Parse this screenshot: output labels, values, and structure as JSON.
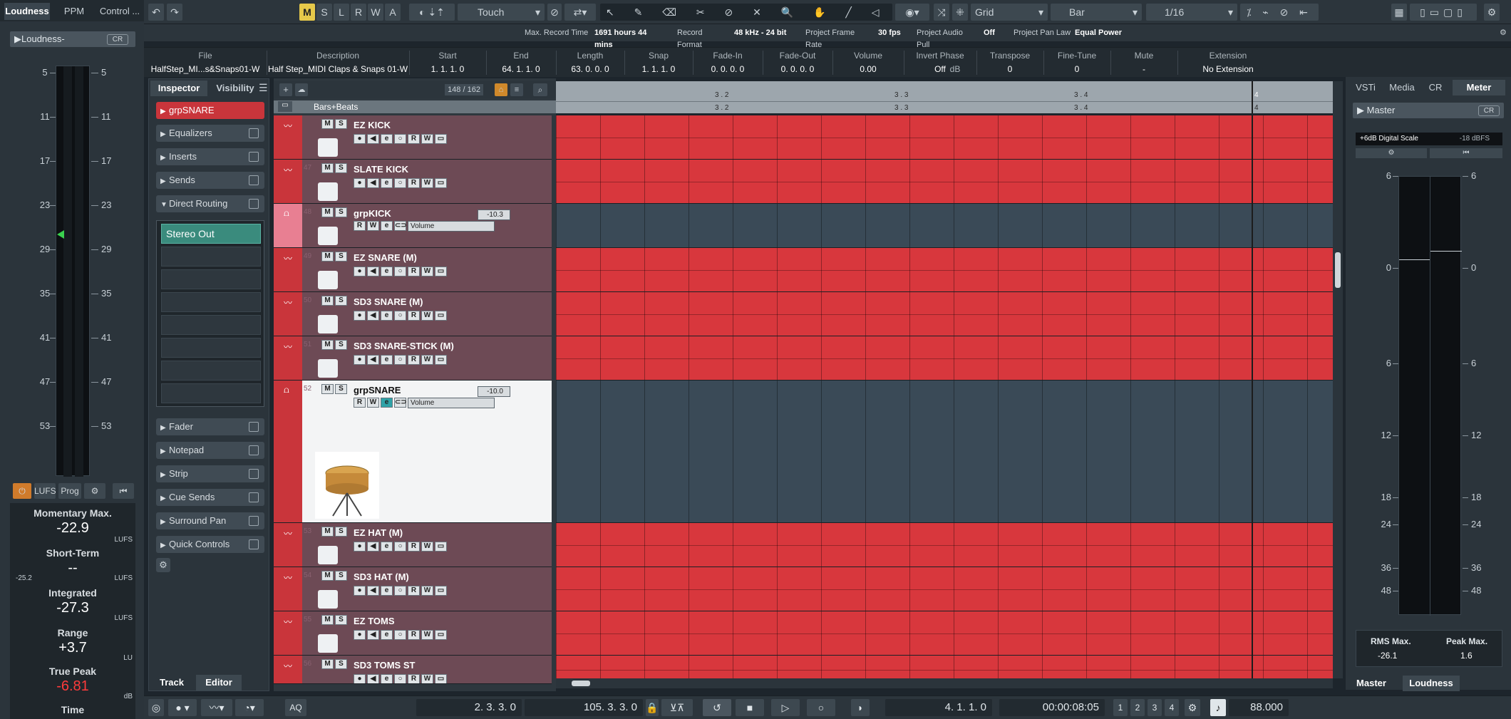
{
  "left_panel": {
    "tabs": [
      "Loudness",
      "PPM",
      "Control ..."
    ],
    "preset": "▶Loudness-",
    "cr": "CR",
    "scale": [
      "5",
      "11",
      "17",
      "23",
      "29",
      "35",
      "41",
      "47",
      "53"
    ],
    "buttons": [
      "LUFS",
      "Prog"
    ],
    "momentary_label": "Momentary Max.",
    "momentary_value": "-22.9",
    "short_label": "Short-Term",
    "short_value": "--",
    "short_min": "-25.2",
    "integrated_label": "Integrated",
    "integrated_value": "-27.3",
    "range_label": "Range",
    "range_value": "+3.7",
    "truepeak_label": "True Peak",
    "truepeak_value": "-6.81",
    "time_label": "Time",
    "unit_lufs": "LUFS",
    "unit_lu": "LU",
    "unit_db": "dB"
  },
  "toolbar": {
    "mode_buttons": [
      "M",
      "S",
      "L",
      "R",
      "W",
      "A"
    ],
    "automation_mode": "Touch",
    "snap_type": "Grid",
    "grid": "Bar",
    "quantize": "1/16"
  },
  "infobar": {
    "max_record_label": "Max. Record Time",
    "max_record_value": "1691 hours 44 mins",
    "record_format_label": "Record Format",
    "record_format_value": "48 kHz - 24 bit",
    "frame_rate_label": "Project Frame Rate",
    "frame_rate_value": "30 fps",
    "pull_label": "Project Audio Pull",
    "pull_value": "Off",
    "panlaw_label": "Project Pan Law",
    "panlaw_value": "Equal Power"
  },
  "infoline": {
    "headers": [
      "File",
      "Description",
      "Start",
      "End",
      "Length",
      "Snap",
      "Fade-In",
      "Fade-Out",
      "Volume",
      "Invert Phase",
      "Transpose",
      "Fine-Tune",
      "Mute",
      "Extension"
    ],
    "values": [
      "HalfStep_MI...s&Snaps01-W",
      "Half Step_MIDI Claps & Snaps 01-W",
      "1. 1. 1.   0",
      "64. 1. 1.   0",
      "63. 0. 0.   0",
      "1. 1. 1.   0",
      "0. 0. 0.   0",
      "0. 0. 0.   0",
      "0.00",
      "Off",
      "0",
      "0",
      "-",
      "No Extension"
    ],
    "volume_unit": "dB"
  },
  "inspector": {
    "tabs": [
      "Inspector",
      "Visibility"
    ],
    "track_name": "grpSNARE",
    "sections": [
      "Equalizers",
      "Inserts",
      "Sends",
      "Direct Routing"
    ],
    "route": "Stereo Out",
    "sections2": [
      "Fader",
      "Notepad",
      "Strip",
      "Cue Sends",
      "Surround Pan",
      "Quick Controls"
    ],
    "bottom_tabs": [
      "Track",
      "Editor"
    ]
  },
  "tracklist": {
    "count": "148 / 162",
    "ruler_label": "Bars+Beats",
    "tracks": [
      {
        "num": "",
        "name": "EZ KICK"
      },
      {
        "num": "47",
        "name": "SLATE KICK"
      },
      {
        "num": "48",
        "name": "grpKICK",
        "vol": "-10.3",
        "param": "Volume"
      },
      {
        "num": "49",
        "name": "EZ SNARE (M)"
      },
      {
        "num": "50",
        "name": "SD3 SNARE (M)"
      },
      {
        "num": "51",
        "name": "SD3 SNARE-STICK (M)"
      },
      {
        "num": "52",
        "name": "grpSNARE",
        "vol": "-10.0",
        "param": "Volume"
      },
      {
        "num": "53",
        "name": "EZ HAT (M)"
      },
      {
        "num": "54",
        "name": "SD3 HAT (M)"
      },
      {
        "num": "55",
        "name": "EZ TOMS"
      },
      {
        "num": "56",
        "name": "SD3 TOMS ST"
      }
    ]
  },
  "ruler": {
    "marks": [
      "3 . 2",
      "3 . 3",
      "3 . 4",
      "4"
    ]
  },
  "right_panel": {
    "tabs": [
      "VSTi",
      "Media",
      "CR",
      "Meter"
    ],
    "master": "Master",
    "scale_label": "+6dB Digital Scale",
    "scale_ref": "-18 dBFS",
    "scale": [
      "6",
      "0",
      "6",
      "12",
      "18",
      "24",
      "36",
      "48"
    ],
    "rms_label": "RMS Max.",
    "rms_value": "-26.1",
    "peak_label": "Peak Max.",
    "peak_value": "1.6",
    "bottom_tabs": [
      "Master",
      "Loudness"
    ]
  },
  "transport": {
    "left_locator": "2. 3. 3.   0",
    "right_locator": "105. 3. 3.   0",
    "position": "4. 1. 1.   0",
    "timecode": "00:00:08:05",
    "tempo": "88.000",
    "markers": [
      "1",
      "2",
      "3",
      "4"
    ]
  },
  "colors": {
    "audio_track": "#d8373d",
    "group_track": "#3a4a57",
    "accent_teal": "#3a8b7d",
    "mode_on": "#e6c94a"
  }
}
